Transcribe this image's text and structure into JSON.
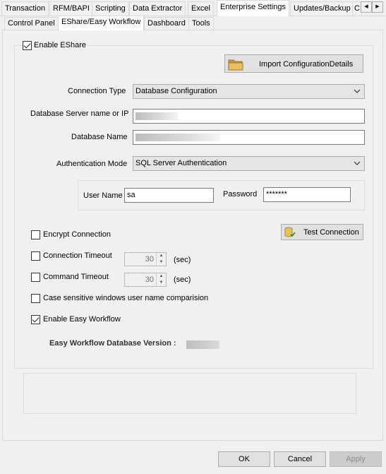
{
  "top_tabs": [
    "Transaction",
    "RFM/BAPI",
    "Scripting",
    "Data Extractor",
    "Excel",
    "Enterprise Settings",
    "Updates/Backup",
    "C"
  ],
  "sub_tabs": [
    "Control Panel",
    "EShare/Easy Workflow",
    "Dashboard",
    "Tools"
  ],
  "enable_eshare": {
    "label": "Enable EShare",
    "checked": true
  },
  "import_button": {
    "label": "Import ConfigurationDetails",
    "icon": "folder-icon"
  },
  "connection_type": {
    "label": "Connection Type",
    "value": "Database Configuration"
  },
  "db_server": {
    "label": "Database Server name or IP",
    "value": ""
  },
  "db_name": {
    "label": "Database Name",
    "value": ""
  },
  "auth_mode": {
    "label": "Authentication Mode",
    "value": "SQL Server Authentication"
  },
  "credentials": {
    "user_label": "User Name",
    "user_value": "sa",
    "password_label": "Password",
    "password_value": "*******"
  },
  "encrypt": {
    "label": "Encrypt Connection",
    "checked": false
  },
  "test_button": {
    "label": "Test Connection",
    "icon": "database-check-icon"
  },
  "conn_timeout": {
    "label": "Connection Timeout",
    "value": "30",
    "unit": "(sec)",
    "checked": false
  },
  "cmd_timeout": {
    "label": "Command Timeout",
    "value": "30",
    "unit": "(sec)",
    "checked": false
  },
  "case_sensitive": {
    "label": "Case sensitive windows user name comparision",
    "checked": false
  },
  "easy_workflow": {
    "label": "Enable Easy Workflow",
    "checked": true
  },
  "version": {
    "label": "Easy Workflow Database Version :",
    "value": ""
  },
  "footer": {
    "ok": "OK",
    "cancel": "Cancel",
    "apply": "Apply"
  }
}
